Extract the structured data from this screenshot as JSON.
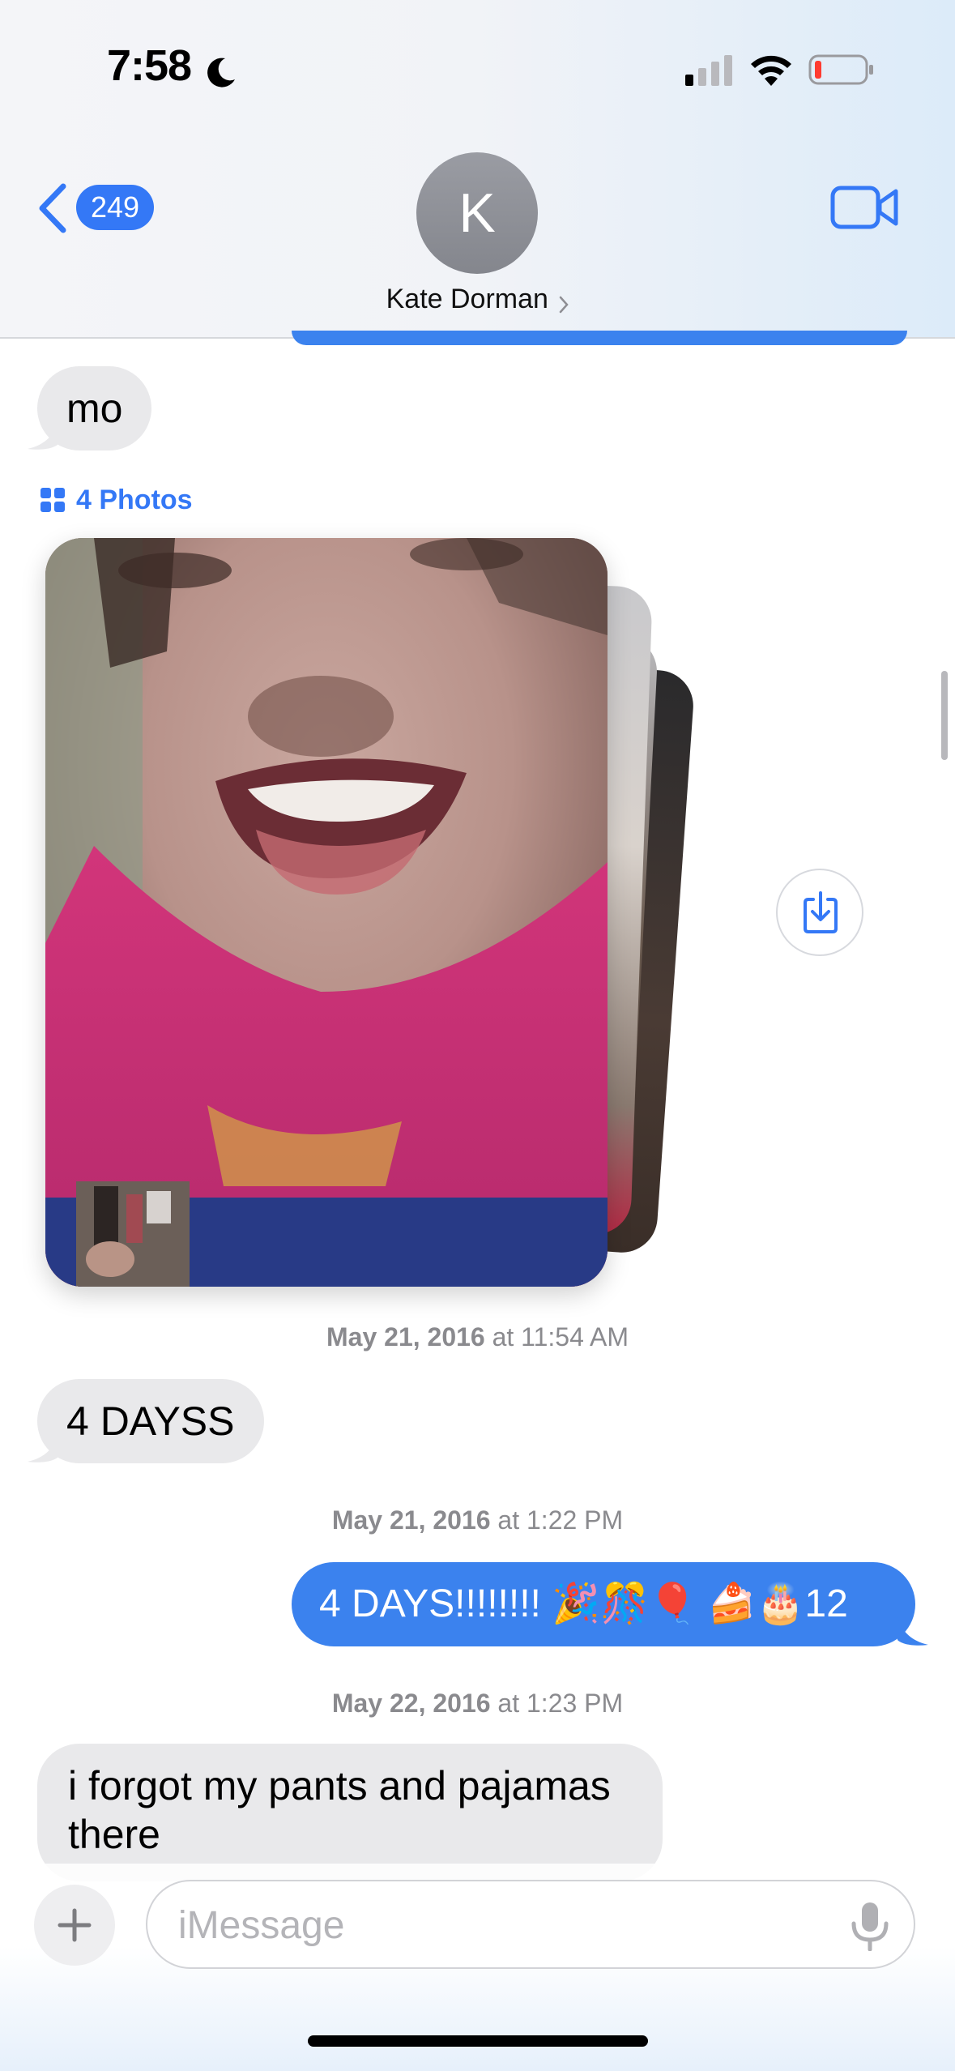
{
  "status_bar": {
    "time": "7:58",
    "focus_icon": "moon-icon",
    "signal_icon": "cellular-signal-icon",
    "wifi_icon": "wifi-icon",
    "battery_icon": "battery-low-icon"
  },
  "header": {
    "back_count": "249",
    "avatar_initial": "K",
    "contact_name": "Kate Dorman",
    "video_icon": "video-camera-icon"
  },
  "colors": {
    "accent": "#3478f6",
    "outgoing_bubble": "#3b82ee",
    "incoming_bubble": "#e9e9eb",
    "timestamp_text": "#8a8a8e"
  },
  "messages": [
    {
      "direction": "incoming",
      "text": "mo"
    },
    {
      "direction": "incoming",
      "type": "photo-stack",
      "label": "4 Photos"
    },
    {
      "type": "timestamp",
      "date": "May 21, 2016",
      "sep": "at",
      "time": "11:54 AM"
    },
    {
      "direction": "incoming",
      "text": "4 DAYSS"
    },
    {
      "type": "timestamp",
      "date": "May 21, 2016",
      "sep": "at",
      "time": "1:22 PM"
    },
    {
      "direction": "outgoing",
      "text": "4 DAYS!!!!!!!! 🎉🎊🎈 🍰🎂12"
    },
    {
      "type": "timestamp",
      "date": "May 22, 2016",
      "sep": "at",
      "time": "1:23 PM"
    },
    {
      "direction": "incoming",
      "lines": [
        "i forgot my pants and pajamas",
        "there"
      ]
    }
  ],
  "input_bar": {
    "placeholder": "iMessage",
    "value": "",
    "plus_icon": "plus-icon",
    "mic_icon": "microphone-icon"
  }
}
